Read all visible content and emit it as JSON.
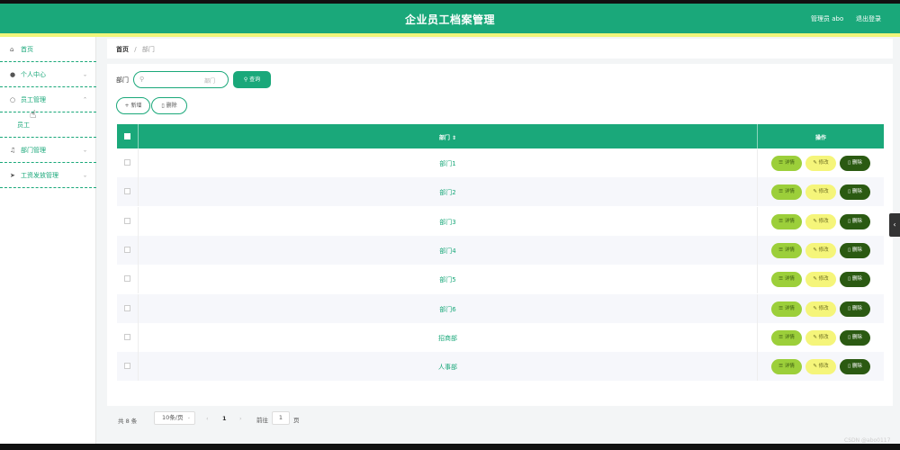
{
  "header": {
    "title": "企业员工档案管理",
    "admin_label": "管理员 abo",
    "logout_label": "退出登录"
  },
  "sidebar": {
    "items": [
      {
        "label": "首页",
        "icon": "home-icon"
      },
      {
        "label": "个人中心",
        "icon": "user-icon"
      },
      {
        "label": "员工管理",
        "icon": "circle-icon"
      },
      {
        "label": "员工",
        "icon": ""
      },
      {
        "label": "部门管理",
        "icon": "bell-icon"
      },
      {
        "label": "工资发放管理",
        "icon": "send-icon"
      }
    ]
  },
  "breadcrumb": {
    "home": "首页",
    "separator": "/",
    "current": "部门"
  },
  "search": {
    "label": "部门",
    "placeholder": "部门",
    "button": "查询"
  },
  "actions": {
    "add": "新增",
    "delete": "删除"
  },
  "table": {
    "column_dept": "部门",
    "column_ops": "操作",
    "rows": [
      "部门1",
      "部门2",
      "部门3",
      "部门4",
      "部门5",
      "部门6",
      "招商部",
      "人事部"
    ],
    "op_detail": "详情",
    "op_edit": "修改",
    "op_delete": "删除"
  },
  "pager": {
    "total": "共 8 条",
    "page_size": "10条/页",
    "current_page": "1",
    "goto_label": "前往",
    "goto_value": "1",
    "page_unit": "页"
  },
  "watermark": "CSDN @abo0117",
  "colors": {
    "primary": "#1aa87a",
    "accent_stripe": "#f0f57a",
    "detail": "#9ccf3a",
    "edit": "#f5f57a",
    "delete": "#2b5a12"
  }
}
